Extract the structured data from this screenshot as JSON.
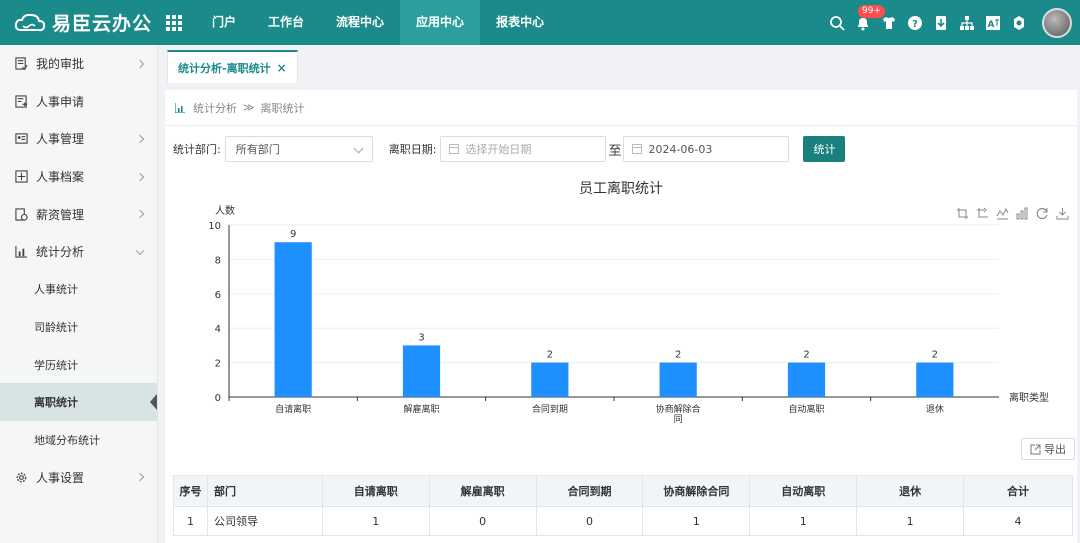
{
  "app": {
    "logo_text": "易臣云办公",
    "nav": [
      "门户",
      "工作台",
      "流程中心",
      "应用中心",
      "报表中心"
    ],
    "nav_active_index": 3,
    "notification_badge": "99+",
    "brand_color": "#1a8a8a"
  },
  "sidebar": {
    "items": [
      {
        "label": "我的审批",
        "icon": "approval-icon"
      },
      {
        "label": "人事申请",
        "icon": "apply-icon"
      },
      {
        "label": "人事管理",
        "icon": "id-card-icon"
      },
      {
        "label": "人事档案",
        "icon": "archive-icon"
      },
      {
        "label": "薪资管理",
        "icon": "salary-icon"
      },
      {
        "label": "统计分析",
        "icon": "chart-icon"
      }
    ],
    "subitems": [
      "人事统计",
      "司龄统计",
      "学历统计",
      "离职统计",
      "地域分布统计"
    ],
    "subitem_active_index": 3,
    "settings": {
      "label": "人事设置",
      "icon": "gear-icon"
    }
  },
  "tab": {
    "label": "统计分析-离职统计",
    "close": "×"
  },
  "breadcrumb": {
    "parent": "统计分析",
    "sep": "≫",
    "current": "离职统计"
  },
  "filter": {
    "dept_label": "统计部门:",
    "dept_value": "所有部门",
    "date_label": "离职日期:",
    "date_start_placeholder": "选择开始日期",
    "to": "至",
    "date_end": "2024-06-03",
    "submit": "统计"
  },
  "chart_data": {
    "type": "bar",
    "title": "员工离职统计",
    "xlabel": "离职类型",
    "ylabel": "人数",
    "categories": [
      "自请离职",
      "解雇离职",
      "合同到期",
      "协商解除合同",
      "自动离职",
      "退休"
    ],
    "values": [
      9,
      3,
      2,
      2,
      2,
      2
    ],
    "ylim": [
      0,
      10
    ],
    "yticks": [
      0,
      2,
      4,
      6,
      8,
      10
    ],
    "bar_color": "#1e90ff",
    "grid": true
  },
  "export_label": "导出",
  "table": {
    "headers": [
      "序号",
      "部门",
      "自请离职",
      "解雇离职",
      "合同到期",
      "协商解除合同",
      "自动离职",
      "退休",
      "合计"
    ],
    "rows": [
      [
        "1",
        "公司领导",
        "1",
        "0",
        "0",
        "1",
        "1",
        "1",
        "4"
      ]
    ]
  }
}
